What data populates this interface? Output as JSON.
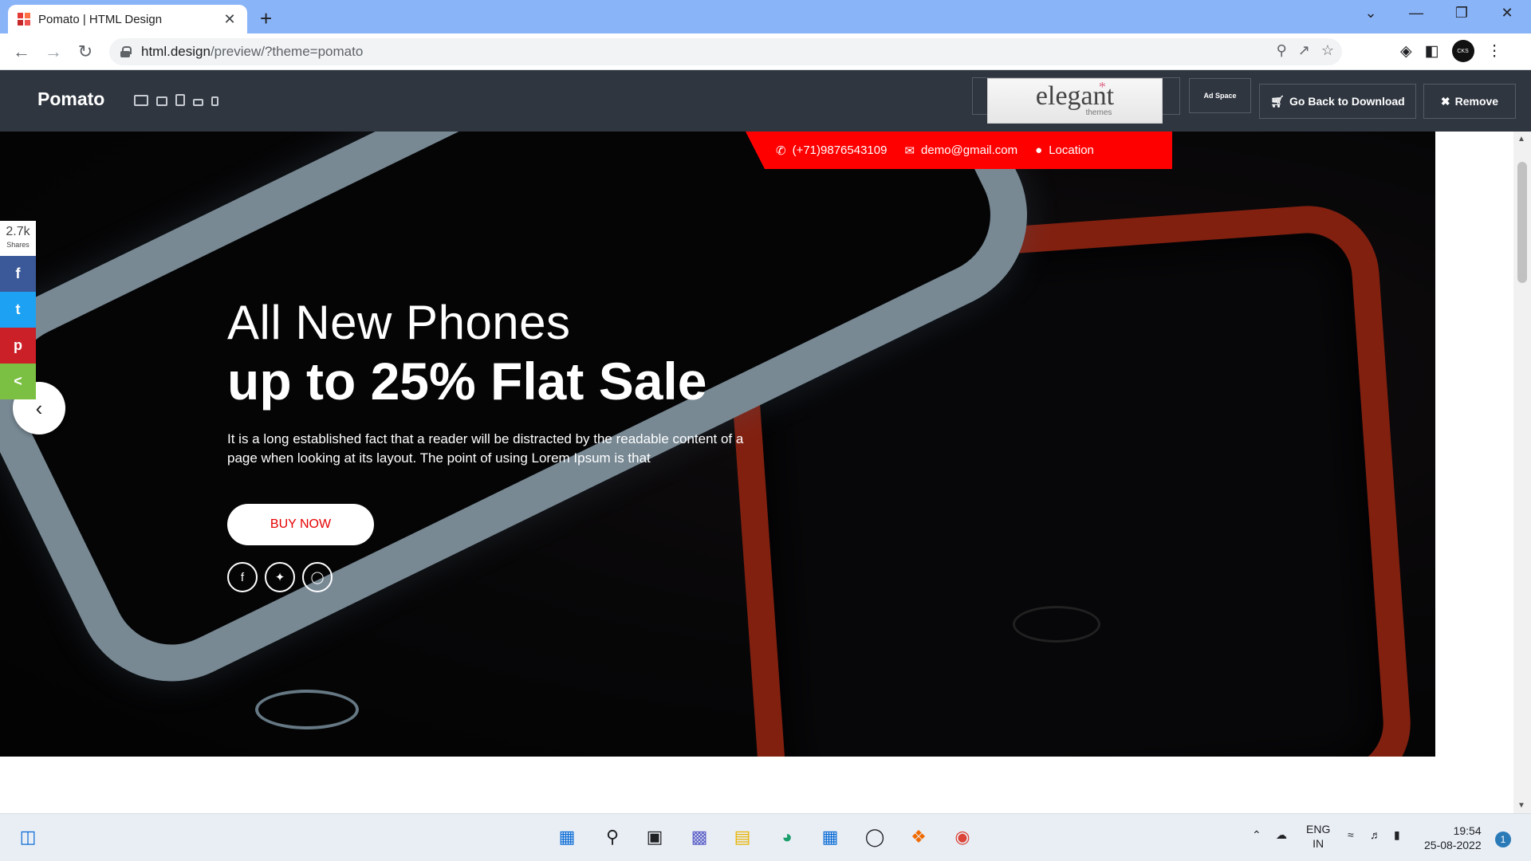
{
  "browser": {
    "tab_title": "Pomato | HTML Design",
    "tab_close": "✕",
    "new_tab": "+",
    "url_host": "html.design",
    "url_path": "/preview/?theme=pomato",
    "profile_label": "CKS",
    "window_controls": [
      "⌄",
      "—",
      "❐",
      "✕"
    ]
  },
  "preview_header": {
    "brand": "Pomato",
    "ad_word": "elegant",
    "ad_sub": "themes",
    "ad_space_label": "Ad Space",
    "go_back_label": "Go Back to Download",
    "remove_label": "Remove"
  },
  "contact": {
    "phone": "(+71)9876543109",
    "email": "demo@gmail.com",
    "location": "Location",
    "strip_color": "#ff0000"
  },
  "hero": {
    "title_line1": "All New Phones",
    "title_line2": "up to 25% Flat Sale",
    "text": "It is a long established fact that a reader will be distracted by the readable content of a page when looking at its layout. The point of using Lorem Ipsum is that",
    "buy_label": "BUY NOW",
    "social_icons": [
      "facebook-icon",
      "twitter-icon",
      "instagram-icon"
    ],
    "prev_arrow": "‹",
    "next_arrow": "›"
  },
  "share_bar": {
    "count": "2.7k",
    "count_label": "Shares",
    "buttons": [
      {
        "name": "facebook",
        "glyph": "f",
        "color": "#3b5998"
      },
      {
        "name": "twitter",
        "glyph": "t",
        "color": "#1da1f2"
      },
      {
        "name": "pinterest",
        "glyph": "p",
        "color": "#cb2027"
      },
      {
        "name": "share",
        "glyph": "<",
        "color": "#7bc043"
      }
    ]
  },
  "taskbar": {
    "lang_line1": "ENG",
    "lang_line2": "IN",
    "time": "19:54",
    "date": "25-08-2022",
    "notifications": "1"
  }
}
